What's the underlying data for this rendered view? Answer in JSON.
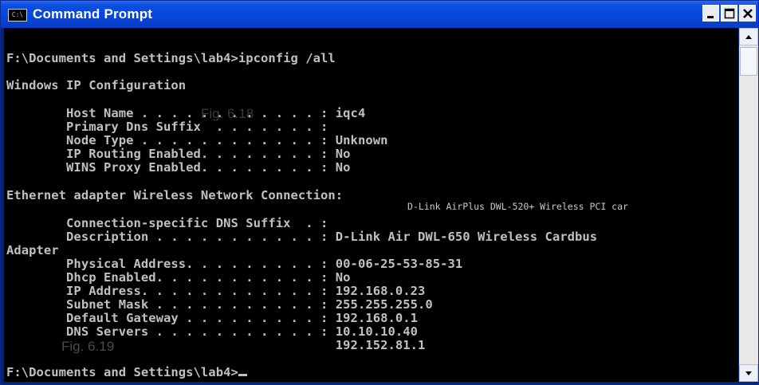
{
  "window": {
    "title": "Command Prompt",
    "icon": "cmd-window-icon",
    "icon_text": "C:\\",
    "buttons": [
      "minimize-icon",
      "maximize-icon",
      "close-icon"
    ],
    "accent": "#0a4ee0"
  },
  "console": {
    "lines": [
      "F:\\Documents and Settings\\lab4>ipconfig /all",
      "Windows IP Configuration",
      "        Host Name . . . . . . . . . . . . : iqc4",
      "        Primary Dns Suffix  . . . . . . . :",
      "        Node Type . . . . . . . . . . . . : Unknown",
      "        IP Routing Enabled. . . . . . . . : No",
      "        WINS Proxy Enabled. . . . . . . . : No",
      "Ethernet adapter Wireless Network Connection:",
      "        Connection-specific DNS Suffix  . :",
      "        Description . . . . . . . . . . . : D-Link Air DWL-650 Wireless Cardbus",
      "Adapter",
      "        Physical Address. . . . . . . . . : 00-06-25-53-85-31",
      "        Dhcp Enabled. . . . . . . . . . . : No",
      "        IP Address. . . . . . . . . . . . : 192.168.0.23",
      "        Subnet Mask . . . . . . . . . . . : 255.255.255.0",
      "        Default Gateway . . . . . . . . . : 192.168.0.1",
      "        DNS Servers . . . . . . . . . . . : 10.10.10.40",
      "                                            192.152.81.1",
      "F:\\Documents and Settings\\lab4>"
    ],
    "tooltip": "D-Link AirPlus DWL-520+ Wireless PCI car",
    "figure_label_1": "Fig. 6.18",
    "figure_label_2": "Fig. 6.19",
    "text_color": "#c0c0c0",
    "background": "#000000"
  },
  "scrollbar": {
    "up_icon": "scroll-up-arrow-icon",
    "down_icon": "scroll-down-arrow-icon"
  }
}
